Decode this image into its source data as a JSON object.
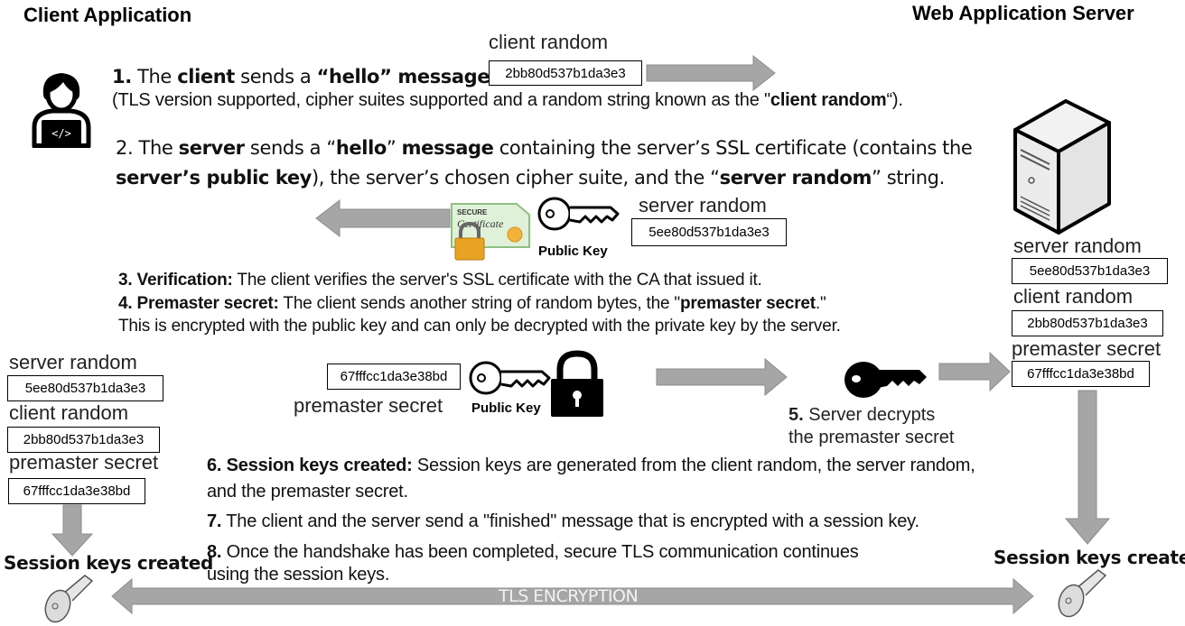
{
  "headers": {
    "client": "Client Application",
    "server": "Web Application Server"
  },
  "values": {
    "client_random": "2bb80d537b1da3e3",
    "server_random": "5ee80d537b1da3e3",
    "premaster_secret": "67fffcc1da3e38bd"
  },
  "labels": {
    "client_random": "client random",
    "server_random": "server random",
    "premaster_secret": "premaster secret",
    "public_key": "Public Key",
    "session_keys_created": "Session keys created",
    "tls_encryption": "TLS ENCRYPTION"
  },
  "steps": {
    "s1": {
      "num": "1.",
      "a": " The ",
      "b": "client",
      "c": " sends a ",
      "d": "“hello” message",
      "e": ".",
      "sub_a": "(TLS version supported, cipher suites supported and a random string known as the \"",
      "sub_b": "client random",
      "sub_c": "“)."
    },
    "s2": {
      "a": "2. The ",
      "b": "server",
      "c": " sends a “",
      "d": "hello",
      "e": "” ",
      "f": "message",
      "g": " containing the server’s SSL certificate (contains the",
      "h": "server’s public key",
      "i": "), the server’s chosen cipher suite, and the “",
      "j": "server random",
      "k": "” string."
    },
    "s3": {
      "a": "3. Verification:",
      "b": " The client verifies the server's SSL certificate with the CA that issued it."
    },
    "s4": {
      "a": "4. Premaster secret:",
      "b": " The client sends another string of random bytes, the \"",
      "c": "premaster secret",
      "d": ".\"",
      "e": "This is encrypted with the public key and can only be decrypted with the private key by the server."
    },
    "s5": {
      "a": "5.",
      "b": " Server decrypts",
      "c": "the premaster secret"
    },
    "s6": {
      "a": "6. Session keys created:",
      "b": " Session keys are generated from the client random, the server random,",
      "c": "and the premaster secret."
    },
    "s7": {
      "a": "7.",
      "b": " The client and the server send a \"finished\" message that is encrypted with a session key."
    },
    "s8": {
      "a": "8.",
      "b": " Once the handshake has been completed, secure ",
      "c": "TLS communication continues",
      "d": "using the session keys."
    }
  },
  "colors": {
    "arrow": "#a6a6a6",
    "arrow_border": "#8c8c8c"
  }
}
